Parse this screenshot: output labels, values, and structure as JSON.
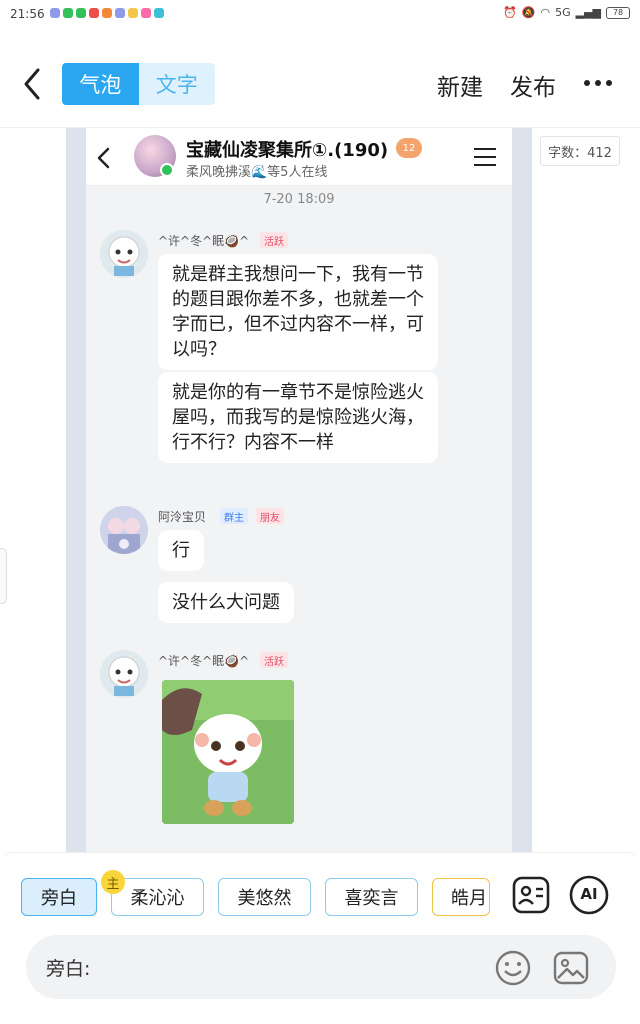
{
  "status_bar": {
    "time": "21:56",
    "signal_label": "5G",
    "battery": "78"
  },
  "editor": {
    "tabs": [
      {
        "label": "气泡",
        "selected": true
      },
      {
        "label": "文字",
        "selected": false
      }
    ],
    "new_label": "新建",
    "publish_label": "发布",
    "word_count": "字数：412"
  },
  "chat": {
    "group_name": "宝藏仙凌聚集所①.(190)",
    "group_badge": "12",
    "online_text": "柔风晚拂溪🌊等5人在线",
    "timestamp": "7-20 18:09",
    "messages": [
      {
        "nickname": "^许^冬^眠🥥^",
        "tag": "活跃",
        "bubbles": [
          "就是群主我想问一下，我有一节的题目跟你差不多，也就差一个字而已，但不过内容不一样，可以吗？",
          "就是你的有一章节不是惊险逃火屋吗，而我写的是惊险逃火海，行不行？内容不一样"
        ]
      },
      {
        "nickname": "阿泠宝贝",
        "tags": [
          "群主",
          "朋友"
        ],
        "bubbles": [
          "行",
          "没什么大问题"
        ]
      },
      {
        "nickname": "^许^冬^眠🥥^",
        "tag": "活跃",
        "sticker": "pleasant-goat-sticker"
      }
    ]
  },
  "roles": {
    "owner_mark": "主",
    "chips": [
      {
        "label": "旁白",
        "selected": true
      },
      {
        "label": "柔沁沁",
        "selected": false
      },
      {
        "label": "美悠然",
        "selected": false
      },
      {
        "label": "喜奕言",
        "selected": false
      },
      {
        "label": "皓月",
        "selected": false
      }
    ],
    "ai_label": "AI"
  },
  "input": {
    "label": "旁白:"
  },
  "colors": {
    "accent": "#2aa7f0",
    "accent_light": "#dff1fd",
    "chip_border": "#8fcbea",
    "tag_active": "#e0506a",
    "tag_owner": "#3f7be8"
  }
}
